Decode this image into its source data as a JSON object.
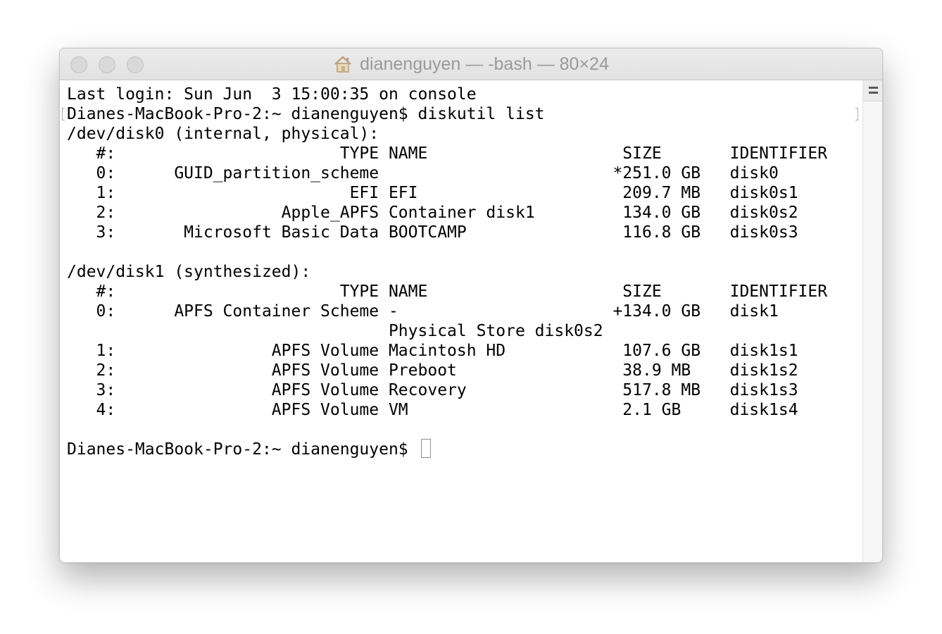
{
  "window": {
    "title": "dianenguyen — -bash — 80×24"
  },
  "terminal": {
    "lines": [
      "Last login: Sun Jun  3 15:00:35 on console",
      "Dianes-MacBook-Pro-2:~ dianenguyen$ diskutil list",
      "/dev/disk0 (internal, physical):",
      "   #:                       TYPE NAME                    SIZE       IDENTIFIER",
      "   0:      GUID_partition_scheme                        *251.0 GB   disk0",
      "   1:                        EFI EFI                     209.7 MB   disk0s1",
      "   2:                 Apple_APFS Container disk1         134.0 GB   disk0s2",
      "   3:       Microsoft Basic Data BOOTCAMP                116.8 GB   disk0s3",
      "",
      "/dev/disk1 (synthesized):",
      "   #:                       TYPE NAME                    SIZE       IDENTIFIER",
      "   0:      APFS Container Scheme -                      +134.0 GB   disk1",
      "                                 Physical Store disk0s2",
      "   1:                APFS Volume Macintosh HD            107.6 GB   disk1s1",
      "   2:                APFS Volume Preboot                 38.9 MB    disk1s2",
      "   3:                APFS Volume Recovery                517.8 MB   disk1s3",
      "   4:                APFS Volume VM                      2.1 GB     disk1s4",
      "",
      "Dianes-MacBook-Pro-2:~ dianenguyen$ "
    ]
  }
}
